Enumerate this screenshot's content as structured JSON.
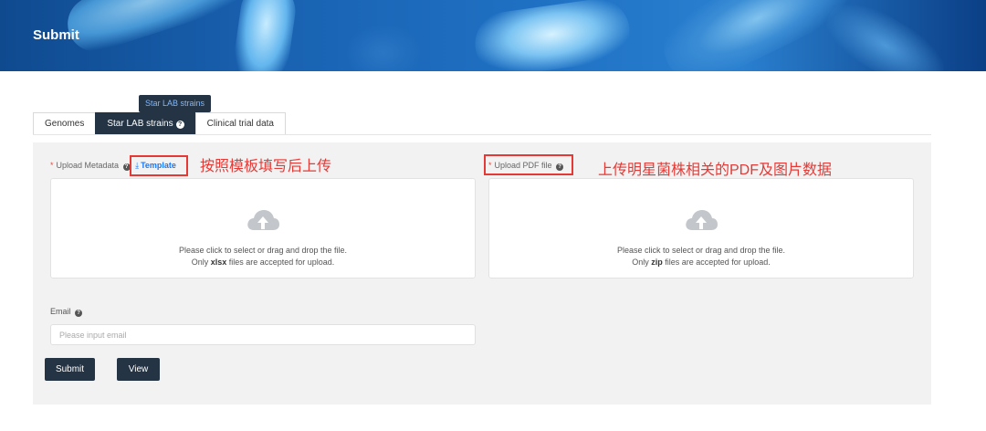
{
  "header": {
    "title": "Submit"
  },
  "tooltip": {
    "text": "Star LAB strains"
  },
  "tabs": [
    {
      "label": "Genomes"
    },
    {
      "label": "Star LAB strains",
      "help_icon": "question-circle-icon"
    },
    {
      "label": "Clinical trial data"
    }
  ],
  "upload_metadata": {
    "required_mark": "*",
    "label": "Upload Metadata",
    "help_icon": "question-circle-icon",
    "template_icon": "download-icon",
    "template_label": "Template",
    "drop_line1": "Please click to select or drag and drop the file.",
    "drop_line2_prefix": "Only ",
    "drop_line2_ext": "xlsx",
    "drop_line2_suffix": " files are accepted for upload."
  },
  "upload_pdf": {
    "required_mark": "*",
    "label": "Upload PDF file",
    "help_icon": "question-circle-icon",
    "drop_line1": "Please click to select or drag and drop the file.",
    "drop_line2_prefix": "Only ",
    "drop_line2_ext": "zip",
    "drop_line2_suffix": " files are accepted for upload."
  },
  "annotations": {
    "left": "按照模板填写后上传",
    "right": "上传明星菌株相关的PDF及图片数据"
  },
  "email": {
    "label": "Email",
    "help_icon": "question-circle-icon",
    "value": "",
    "placeholder": "Please input email"
  },
  "buttons": {
    "submit": "Submit",
    "view": "View"
  },
  "colors": {
    "dark_navy": "#253444",
    "link_blue": "#1677ff",
    "annotation_red": "#e53935",
    "panel_bg": "#f2f2f2"
  }
}
